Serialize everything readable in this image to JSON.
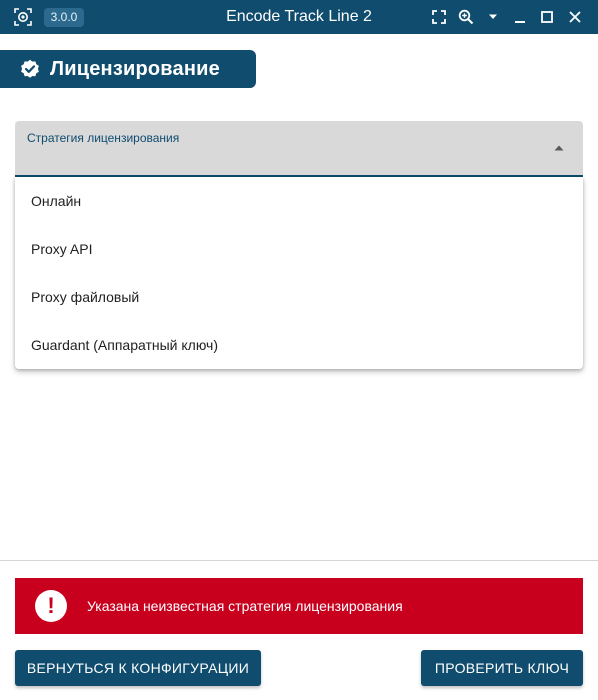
{
  "titlebar": {
    "version": "3.0.0",
    "title": "Encode Track Line 2",
    "icons": [
      "app-logo-icon",
      "fullscreen-icon",
      "zoom-icon",
      "dropdown-caret-icon",
      "minimize-icon",
      "maximize-icon",
      "close-icon"
    ]
  },
  "section": {
    "title": "Лицензирование",
    "icon": "verified-badge-icon"
  },
  "licensing_select": {
    "label": "Стратегия лицензирования",
    "value": "",
    "options": [
      "Онлайн",
      "Proxy API",
      "Proxy файловый",
      "Guardant (Аппаратный ключ)"
    ]
  },
  "error": {
    "icon": "error-exclamation-icon",
    "message": "Указана неизвестная стратегия лицензирования"
  },
  "footer": {
    "back_label": "ВЕРНУТЬСЯ К КОНФИГУРАЦИИ",
    "check_label": "ПРОВЕРИТЬ КЛЮЧ"
  },
  "colors": {
    "primary": "#0f4c6e",
    "error": "#c8001e",
    "field_bg": "#d9d9d9"
  }
}
